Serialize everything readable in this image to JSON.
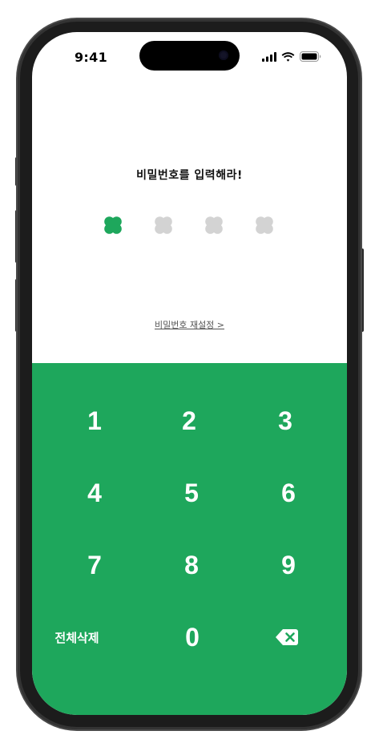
{
  "status": {
    "time": "9:41"
  },
  "title": "비밀번호를 입력해라!",
  "pins": [
    {
      "filled": true
    },
    {
      "filled": false
    },
    {
      "filled": false
    },
    {
      "filled": false
    }
  ],
  "reset_link": "비밀번호 재설정 >",
  "keypad": {
    "keys": [
      "1",
      "2",
      "3",
      "4",
      "5",
      "6",
      "7",
      "8",
      "9"
    ],
    "delete_all": "전체삭제",
    "zero": "0"
  },
  "colors": {
    "accent": "#1ea75c",
    "pin_empty": "#d3d3d3"
  }
}
